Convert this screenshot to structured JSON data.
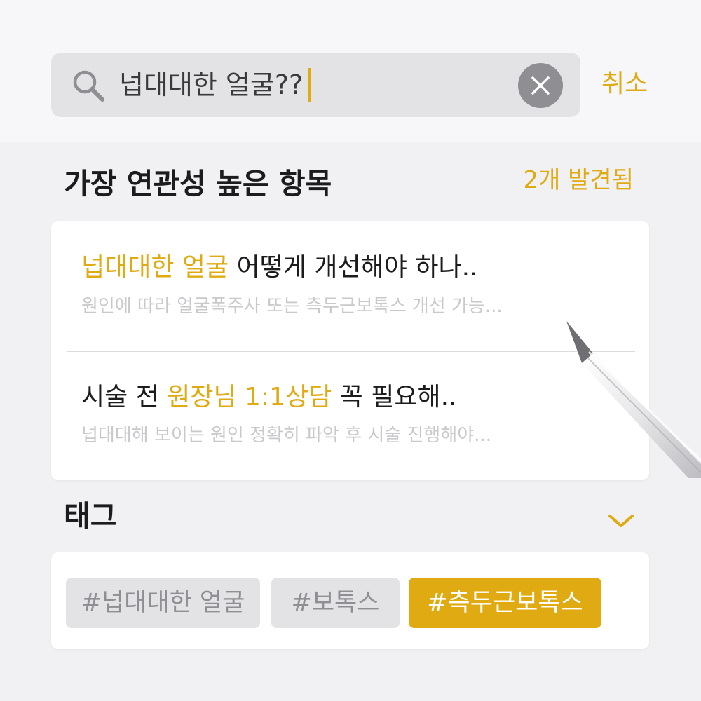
{
  "search": {
    "query": "넙대대한 얼굴??",
    "cancel_label": "취소"
  },
  "results_section": {
    "title": "가장 연관성 높은 항목",
    "count_label": "2개 발견됨",
    "items": [
      {
        "title_highlight": "넙대대한 얼굴",
        "title_rest": " 어떻게 개선해야 하나..",
        "snippet": "원인에 따라 얼굴폭주사 또는 측두근보톡스 개선 가능..."
      },
      {
        "title_prefix": "시술 전 ",
        "title_highlight": "원장님 1:1상담",
        "title_rest": " 꼭 필요해..",
        "snippet": "넙대대해 보이는 원인 정확히 파악 후 시술 진행해야..."
      }
    ]
  },
  "tags_section": {
    "title": "태그",
    "tags": [
      {
        "label": "#넙대대한 얼굴",
        "selected": false
      },
      {
        "label": "#보톡스",
        "selected": false
      },
      {
        "label": "#측두근보톡스",
        "selected": true
      }
    ]
  },
  "icons": {
    "search": "search-icon",
    "clear": "close-icon",
    "expand": "chevron-down-icon"
  },
  "colors": {
    "accent": "#e0aa12",
    "background": "#f1f1f4",
    "search_field": "#e3e3e6",
    "tag_inactive": "#e3e3e6",
    "snippet_text": "#c9c9cc"
  }
}
